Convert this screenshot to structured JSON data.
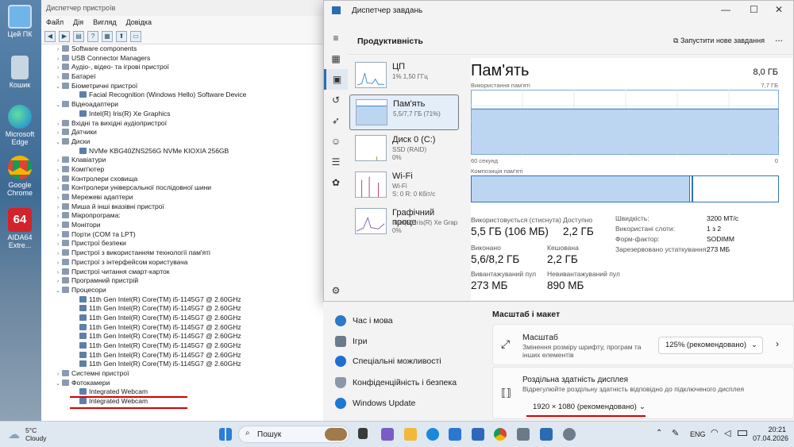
{
  "desktop": {
    "icons": [
      "Цей ПК",
      "Кошик",
      "Microsoft Edge",
      "Google Chrome",
      "AIDA64 Extre..."
    ]
  },
  "devmgr": {
    "title": "Диспетчер пристроїв",
    "menu": [
      "Файл",
      "Дія",
      "Вигляд",
      "Довідка"
    ],
    "tree": [
      {
        "t": "Software components",
        "l": 1,
        "x": ">"
      },
      {
        "t": "USB Connector Managers",
        "l": 1,
        "x": ">"
      },
      {
        "t": "Аудіо-, відео- та ігрові пристрої",
        "l": 1,
        "x": ">"
      },
      {
        "t": "Батареї",
        "l": 1,
        "x": ">"
      },
      {
        "t": "Біометричні пристрої",
        "l": 1,
        "x": "v"
      },
      {
        "t": "Facial Recognition (Windows Hello) Software Device",
        "l": 2,
        "x": ""
      },
      {
        "t": "Відеоадаптери",
        "l": 1,
        "x": "v"
      },
      {
        "t": "Intel(R) Iris(R) Xe Graphics",
        "l": 2,
        "x": ""
      },
      {
        "t": "Вхідні та вихідні аудіопристрої",
        "l": 1,
        "x": ">"
      },
      {
        "t": "Датчики",
        "l": 1,
        "x": ">"
      },
      {
        "t": "Диски",
        "l": 1,
        "x": "v"
      },
      {
        "t": "NVMe KBG40ZNS256G NVMe KIOXIA 256GB",
        "l": 2,
        "x": ""
      },
      {
        "t": "Клавіатури",
        "l": 1,
        "x": ">"
      },
      {
        "t": "Комп'ютер",
        "l": 1,
        "x": ">"
      },
      {
        "t": "Контролери сховища",
        "l": 1,
        "x": ">"
      },
      {
        "t": "Контролери універсальної послідовної шини",
        "l": 1,
        "x": ">"
      },
      {
        "t": "Мережеві адаптери",
        "l": 1,
        "x": ">"
      },
      {
        "t": "Миша й інші вказівні пристрої",
        "l": 1,
        "x": ">"
      },
      {
        "t": "Мікропрограма:",
        "l": 1,
        "x": ">"
      },
      {
        "t": "Монітори",
        "l": 1,
        "x": ">"
      },
      {
        "t": "Порти (COM та LPT)",
        "l": 1,
        "x": ">"
      },
      {
        "t": "Пристрої безпеки",
        "l": 1,
        "x": ">"
      },
      {
        "t": "Пристрої з використанням технології пам'яті",
        "l": 1,
        "x": ">"
      },
      {
        "t": "Пристрої з інтерфейсом користувача",
        "l": 1,
        "x": ">"
      },
      {
        "t": "Пристрої читання смарт-карток",
        "l": 1,
        "x": ">"
      },
      {
        "t": "Програмний пристрій",
        "l": 1,
        "x": ">"
      },
      {
        "t": "Процесори",
        "l": 1,
        "x": "v"
      },
      {
        "t": "11th Gen Intel(R) Core(TM) i5-1145G7 @ 2.60GHz",
        "l": 2,
        "x": ""
      },
      {
        "t": "11th Gen Intel(R) Core(TM) i5-1145G7 @ 2.60GHz",
        "l": 2,
        "x": ""
      },
      {
        "t": "11th Gen Intel(R) Core(TM) i5-1145G7 @ 2.60GHz",
        "l": 2,
        "x": ""
      },
      {
        "t": "11th Gen Intel(R) Core(TM) i5-1145G7 @ 2.60GHz",
        "l": 2,
        "x": ""
      },
      {
        "t": "11th Gen Intel(R) Core(TM) i5-1145G7 @ 2.60GHz",
        "l": 2,
        "x": ""
      },
      {
        "t": "11th Gen Intel(R) Core(TM) i5-1145G7 @ 2.60GHz",
        "l": 2,
        "x": ""
      },
      {
        "t": "11th Gen Intel(R) Core(TM) i5-1145G7 @ 2.60GHz",
        "l": 2,
        "x": ""
      },
      {
        "t": "11th Gen Intel(R) Core(TM) i5-1145G7 @ 2.60GHz",
        "l": 2,
        "x": ""
      },
      {
        "t": "Системні пристрої",
        "l": 1,
        "x": ">"
      },
      {
        "t": "Фотокамери",
        "l": 1,
        "x": "v"
      },
      {
        "t": "Integrated Webcam",
        "l": 2,
        "x": ""
      },
      {
        "t": "Integrated Webcam",
        "l": 2,
        "x": ""
      }
    ]
  },
  "taskmgr": {
    "title": "Диспетчер завдань",
    "page": "Продуктивність",
    "new_task": "Запустити нове завдання",
    "more": "...",
    "cards": [
      {
        "name": "ЦП",
        "sub": "1% 1,50 ГГц",
        "color": "#3f8bd0"
      },
      {
        "name": "Пам'ять",
        "sub": "5,5/7,7 ГБ (71%)",
        "color": "#3f8bd0"
      },
      {
        "name": "Диск 0 (C:)",
        "sub": "SSD (RAID)",
        "sub2": "0%",
        "color": "#7aa82c"
      },
      {
        "name": "Wi-Fi",
        "sub": "Wi-Fi",
        "sub2": "S: 0 R: 0 Кбіт/с",
        "color": "#b83b7a"
      },
      {
        "name": "Графічний проце",
        "sub": "Intel(R) Iris(R) Xe Graph",
        "sub2": "0%",
        "color": "#8a5bbf"
      }
    ],
    "memory": {
      "title": "Пам'ять",
      "total": "8,0 ГБ",
      "usage_label": "Використання пам'яті",
      "usage_max": "7,7 ГБ",
      "time_left": "60 секунд",
      "time_right": "0",
      "comp_label": "Композиція пам'яті",
      "usage_pct": 71,
      "stats": {
        "in_use_l": "Використовується (стиснута)",
        "in_use_v": "5,5 ГБ (106 МБ)",
        "avail_l": "Доступно",
        "avail_v": "2,2 ГБ",
        "commit_l": "Виконано",
        "commit_v": "5,6/8,2 ГБ",
        "cached_l": "Кешована",
        "cached_v": "2,2 ГБ",
        "paged_l": "Вивантажуваний пул",
        "paged_v": "273 МБ",
        "nonpaged_l": "Невивантажуваний пул",
        "nonpaged_v": "890 МБ"
      },
      "specs": [
        [
          "Швидкість:",
          "3200 МТ/с"
        ],
        [
          "Використані слоти:",
          "1 з 2"
        ],
        [
          "Форм-фактор:",
          "SODIMM"
        ],
        [
          "Зарезервовано устаткування:",
          "273 МБ"
        ]
      ]
    }
  },
  "settings": {
    "nav": [
      "Час і мова",
      "Ігри",
      "Спеціальні можливості",
      "Конфіденційність і безпека",
      "Windows Update"
    ],
    "section": "Масштаб і макет",
    "scale_title": "Масштаб",
    "scale_desc": "Змінення розміру шрифту, програм та інших елементів",
    "scale_value": "125% (рекомендовано)",
    "res_title": "Роздільна здатність дисплея",
    "res_desc": "Відрегулюйте роздільну здатність відповідно до  підключеного дисплея",
    "res_value": "1920 × 1080 (рекомендовано)"
  },
  "taskbar": {
    "temp": "5°C",
    "weather": "Cloudy",
    "search": "Пошук",
    "lang": "ENG",
    "time": "20:21",
    "date": "07.04.2026"
  }
}
